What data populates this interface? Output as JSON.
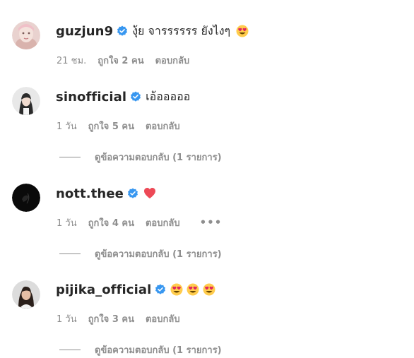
{
  "comments": [
    {
      "username": "guzjun9",
      "text": "งุ้ย จารรรรรร ยังไงๆ",
      "emojis": [
        "heart-eyes-emoji"
      ],
      "time": "21 ชม.",
      "likes": "ถูกใจ 2 คน",
      "reply": "ตอบกลับ",
      "avatar": "avatar-guzjun9"
    },
    {
      "username": "sinofficial",
      "text": "เอ้อออออ",
      "emojis": [],
      "time": "1 วัน",
      "likes": "ถูกใจ 5 คน",
      "reply": "ตอบกลับ",
      "view_replies": "ดูข้อความตอบกลับ (1 รายการ)",
      "avatar": "avatar-sinofficial"
    },
    {
      "username": "nott.thee",
      "text": "",
      "emojis": [
        "red-heart-emoji"
      ],
      "time": "1 วัน",
      "likes": "ถูกใจ 4 คน",
      "reply": "ตอบกลับ",
      "more": "•••",
      "view_replies": "ดูข้อความตอบกลับ (1 รายการ)",
      "avatar": "avatar-nott-thee"
    },
    {
      "username": "pijika_official",
      "text": "",
      "emojis": [
        "heart-eyes-emoji",
        "heart-eyes-emoji",
        "heart-eyes-emoji"
      ],
      "time": "1 วัน",
      "likes": "ถูกใจ 3 คน",
      "reply": "ตอบกลับ",
      "view_replies": "ดูข้อความตอบกลับ (1 รายการ)",
      "avatar": "avatar-pijika"
    }
  ],
  "colors": {
    "verified_badge": "#3897f0",
    "text_primary": "#262626",
    "text_secondary": "#8e8e8e",
    "heart_red": "#ed4956",
    "emoji_yellow": "#ffcc4d",
    "emoji_heart_pink": "#e0245e"
  }
}
